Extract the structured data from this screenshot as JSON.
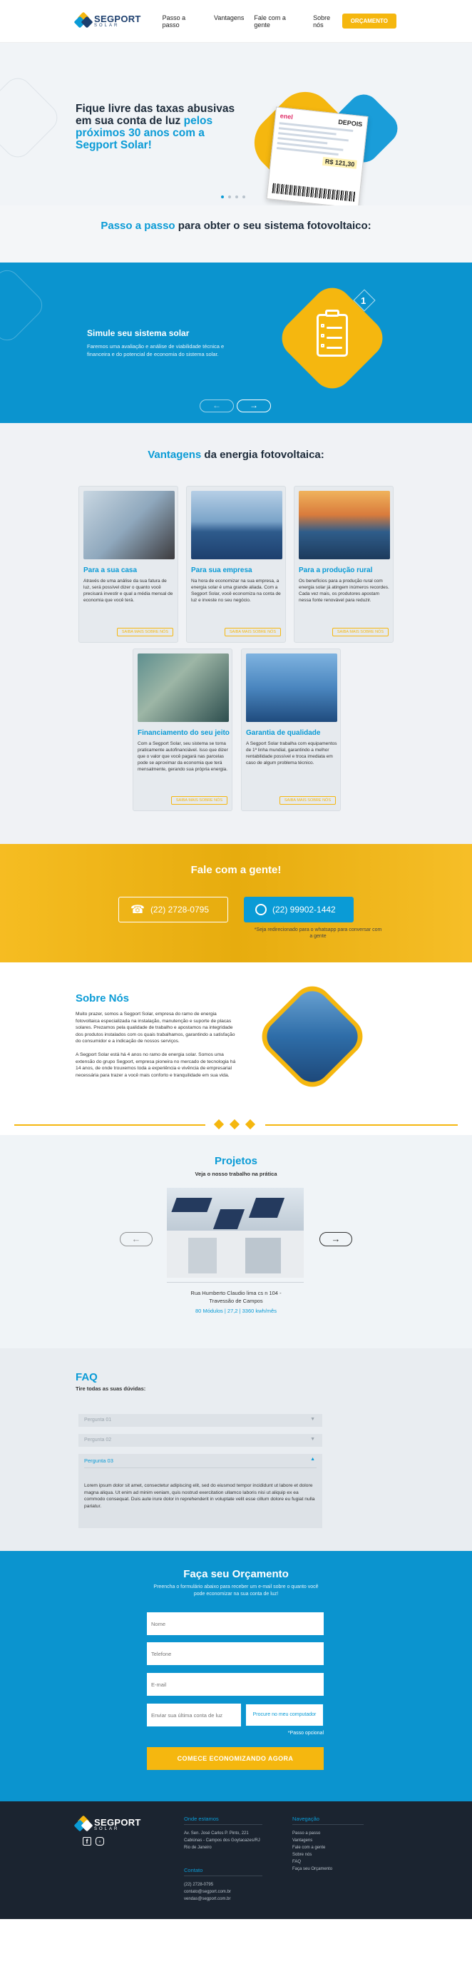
{
  "header": {
    "brand": "SEGPORT",
    "brand_sub": "SOLAR",
    "nav": [
      "Passo a passo",
      "Vantagens",
      "Fale com a gente",
      "Sobre nós"
    ],
    "cta": "ORÇAMENTO"
  },
  "hero": {
    "title_a": "Fique livre das taxas abusivas em sua conta de luz ",
    "title_b": "pelos próximos 30 anos com a Segport Solar!",
    "bill_label": "DEPOIS",
    "bill_brand": "enel",
    "bill_value": "R$ 121,30",
    "slides": 4,
    "active_slide": 0
  },
  "passo": {
    "title_a": "Passo a passo",
    "title_b": " para obter o seu sistema fotovoltaico:",
    "step_title": "Simule seu sistema solar",
    "step_text": "Faremos uma avaliação e análise de viabilidade técnica e financeira e do potencial de economia do sistema solar.",
    "step_number": "1",
    "prev": "←",
    "next": "→"
  },
  "vantagens": {
    "title_a": "Vantagens",
    "title_b": " da energia fotovoltaica:",
    "cards": [
      {
        "title": "Para a sua casa",
        "text": "Através de uma análise da sua fatura de luz, será possível dizer o quanto você precisará investir e qual a média mensal de economia que você terá.",
        "cta": "SAIBA MAIS SOBRE NÓS"
      },
      {
        "title": "Para sua empresa",
        "text": "Na hora de economizar na sua empresa, a energia solar é uma grande aliada. Com a Segport Solar, você economiza na conta de luz e investe no seu negócio.",
        "cta": "SAIBA MAIS SOBRE NÓS"
      },
      {
        "title": "Para a produção rural",
        "text": "Os benefícios para a produção rural com energia solar já atingem inúmeros recordes. Cada vez mais, os produtores apostam nessa fonte renovável para reduzir.",
        "cta": "SAIBA MAIS SOBRE NÓS"
      },
      {
        "title": "Financiamento do seu jeito",
        "text": "Com a Segport Solar, seu sistema se torna praticamente autofinanciável. Isso que dizer que o valor que você pagará nas parcelas pode se aproximar da economia que terá mensalmente, gerando sua própria energia.",
        "cta": "SAIBA MAIS SOBRE NÓS"
      },
      {
        "title": "Garantia de qualidade",
        "text": "A Segport Solar trabalha com equipamentos de 1ª linha mundial, garantindo a melhor rentabilidade possível e troca imediata em caso de algum problema técnico.",
        "cta": "SAIBA MAIS SOBRE NÓS"
      }
    ]
  },
  "fale": {
    "title": "Fale com a gente!",
    "phone": "(22) 2728-0795",
    "whatsapp": "(22) 99902-1442",
    "note": "*Seja redirecionado para o whatsapp para conversar com a gente"
  },
  "sobre": {
    "title": "Sobre Nós",
    "p1": "Muito prazer, somos a Segport Solar, empresa do ramo de energia fotovoltaica especializada na instalação, manutenção e suporte de placas solares. Prezamos pela qualidade de trabalho e apostamos na integridade dos produtos instalados com os quais trabalhamos, garantindo a satisfação do consumidor e a indicação de nossos serviços.",
    "p2": "A Segport Solar está há 4 anos no ramo de energia solar. Somos uma extensão do grupo Segport, empresa pioneira no mercado de tecnologia há 14 anos, de onde trouxemos toda a experiência e vivência de empresarial necessária para trazer a você mais conforto e tranquilidade em sua vida."
  },
  "projetos": {
    "title": "Projetos",
    "subtitle": "Veja o nosso trabalho na prática",
    "address": "Rua Humberto Claudio lima cs n 104 - Travessão de Campos",
    "meta": "80 Módulos | 27,2 | 3360 kwh/mês",
    "prev": "←",
    "next": "→"
  },
  "faq": {
    "title": "FAQ",
    "subtitle": "Tire todas as suas dúvidas:",
    "items": [
      "Pergunta 01",
      "Pergunta 02",
      "Pergunta 03"
    ],
    "open_answer": "Lorem ipsum dolor sit amet, consectetur adipiscing elit, sed do eiusmod tempor incididunt ut labore et dolore magna aliqua. Ut enim ad minim veniam, quis nostrud exercitation ullamco laboris nisi ut aliquip ex ea commodo consequat. Duis aute irure dolor in reprehenderit in voluptate velit esse cillum dolore eu fugiat nulla pariatur."
  },
  "orcamento": {
    "title": "Faça seu Orçamento",
    "desc": "Preencha o formulário abaixo para receber um e-mail sobre o quanto você pode economizar na sua conta de luz!",
    "name_ph": "Nome",
    "phone_ph": "Telefone",
    "email_ph": "E-mail",
    "upload_ph": "Enviar sua última conta de luz",
    "upload_btn": "Procure no meu computador",
    "optional": "*Passo opcional",
    "submit": "COMECE ECONOMIZANDO AGORA"
  },
  "footer": {
    "brand": "SEGPORT",
    "brand_sub": "SOLAR",
    "where_title": "Onde estamos",
    "where": [
      "Av. Sen. José Carlos P. Pinto, 221",
      "Cabiúnas - Campos dos Goytacazes/RJ",
      "Rio de Janeiro"
    ],
    "contact_title": "Contato",
    "contact": [
      "(22) 2728-0795",
      "contato@segport.com.br",
      "vendas@segport.com.br"
    ],
    "nav_title": "Navegação",
    "nav": [
      "Passo a passo",
      "Vantagens",
      "Fale com a gente",
      "Sobre nós",
      "FAQ",
      "Faça seu Orçamento"
    ]
  },
  "colors": {
    "blue": "#0b94cf",
    "yellow": "#f5b70f",
    "dark": "#1b2430"
  }
}
